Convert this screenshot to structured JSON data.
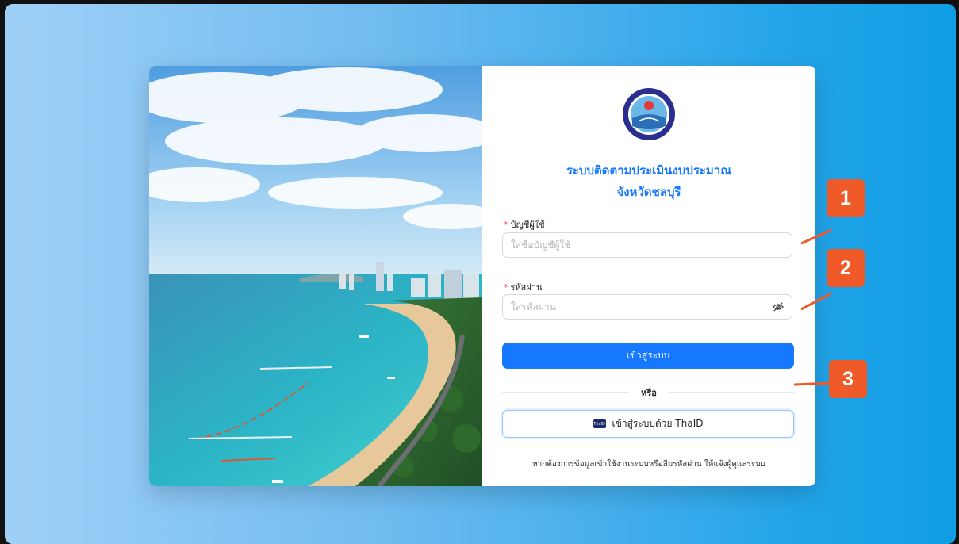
{
  "login": {
    "title_line1": "ระบบติดตามประเมินงบประมาณ",
    "title_line2": "จังหวัดชลบุรี",
    "username": {
      "required_mark": "*",
      "label": "บัญชีผู้ใช้",
      "placeholder": "ใส่ชื่อบัญชีผู้ใช้",
      "value": ""
    },
    "password": {
      "required_mark": "*",
      "label": "รหัสผ่าน",
      "placeholder": "ใส่รหัสผ่าน",
      "value": "",
      "toggle_icon": "eye-slash-icon"
    },
    "login_button": "เข้าสู่ระบบ",
    "divider_text": "หรือ",
    "thaid_button": "เข้าสู่ระบบด้วย ThaID",
    "thaid_logo_text": "ThaID",
    "footnote": "หากต้องการข้อมูลเข้าใช้งานระบบหรือลืมรหัสผ่าน ให้แจ้งผู้ดูแลระบบ"
  },
  "annotations": [
    "1",
    "2",
    "3"
  ],
  "colors": {
    "primary": "#1677ff",
    "callout": "#f05a28",
    "required": "#ff4d4f",
    "background_start": "#9fd0f7",
    "background_end": "#0f9de4"
  },
  "icons": {
    "logo": "province-seal-icon",
    "password_toggle": "eye-slash-icon",
    "thaid": "thaid-logo-icon"
  }
}
